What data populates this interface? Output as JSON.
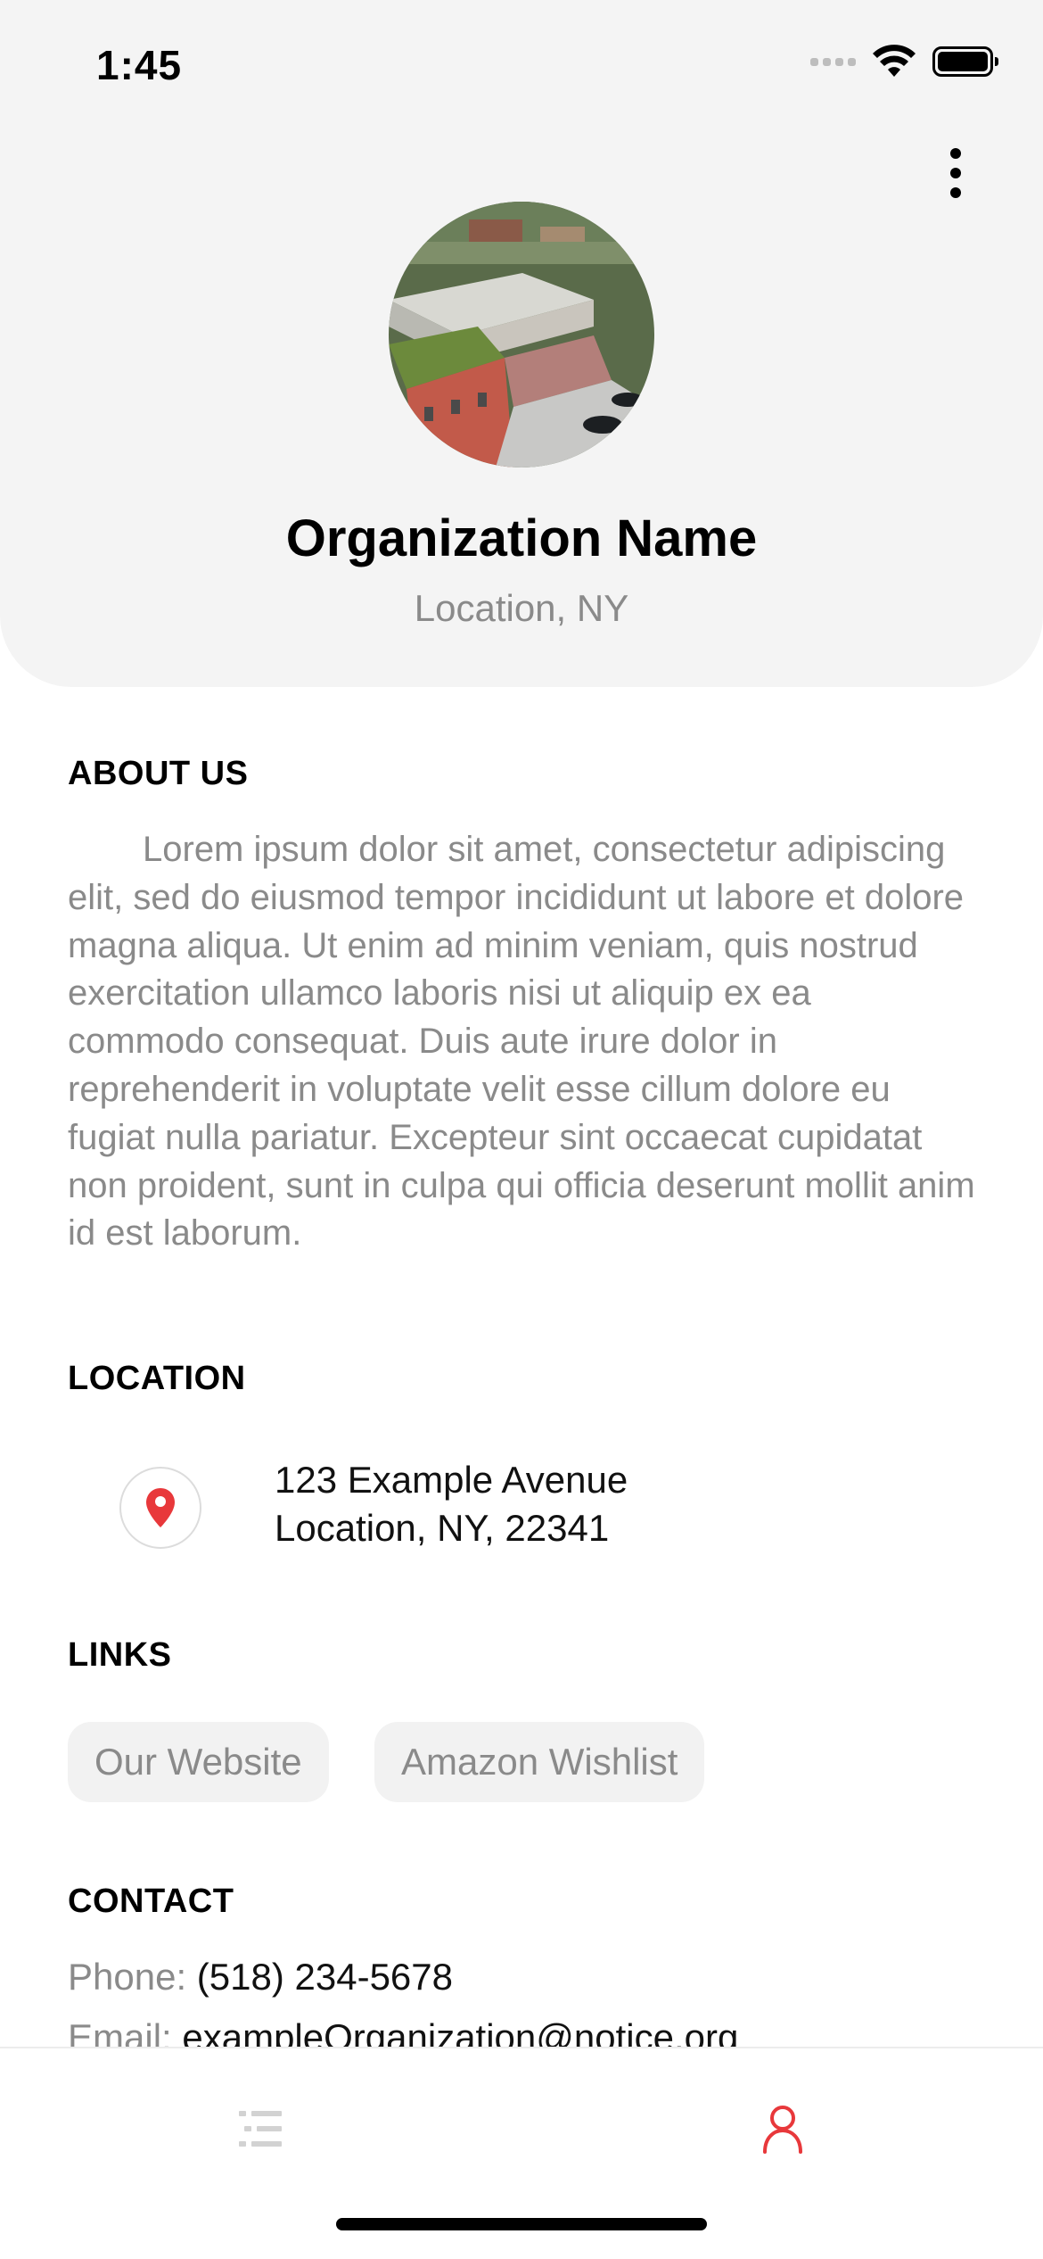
{
  "status_bar": {
    "time": "1:45"
  },
  "header": {
    "menu_icon": "more-vertical-icon",
    "org_name": "Organization Name",
    "location": "Location, NY"
  },
  "about": {
    "title": "ABOUT US",
    "text": "Lorem ipsum dolor sit amet, consectetur adipiscing elit, sed do eiusmod tempor incididunt ut labore et dolore magna aliqua. Ut enim ad minim veniam, quis nostrud exercitation ullamco laboris nisi ut aliquip ex ea commodo consequat. Duis aute irure dolor in reprehenderit in voluptate velit esse cillum dolore eu fugiat nulla pariatur. Excepteur sint occaecat cupidatat non proident, sunt in culpa qui officia deserunt mollit anim id est laborum."
  },
  "location_section": {
    "title": "LOCATION",
    "icon": "map-pin-icon",
    "address_line1": "123 Example Avenue",
    "address_line2": "Location, NY, 22341"
  },
  "links": {
    "title": "LINKS",
    "items": [
      {
        "label": "Our Website"
      },
      {
        "label": "Amazon Wishlist"
      }
    ]
  },
  "contact": {
    "title": "CONTACT",
    "phone_label": "Phone:",
    "phone_value": "(518) 234-5678",
    "email_label": "Email:",
    "email_value": "exampleOrganization@notice.org"
  },
  "tab_bar": {
    "items": [
      {
        "icon": "list-icon",
        "active": false
      },
      {
        "icon": "profile-icon",
        "active": true
      }
    ]
  },
  "colors": {
    "accent": "#e8383b",
    "muted_text": "#8a8a8a",
    "header_bg": "#f4f4f4"
  }
}
